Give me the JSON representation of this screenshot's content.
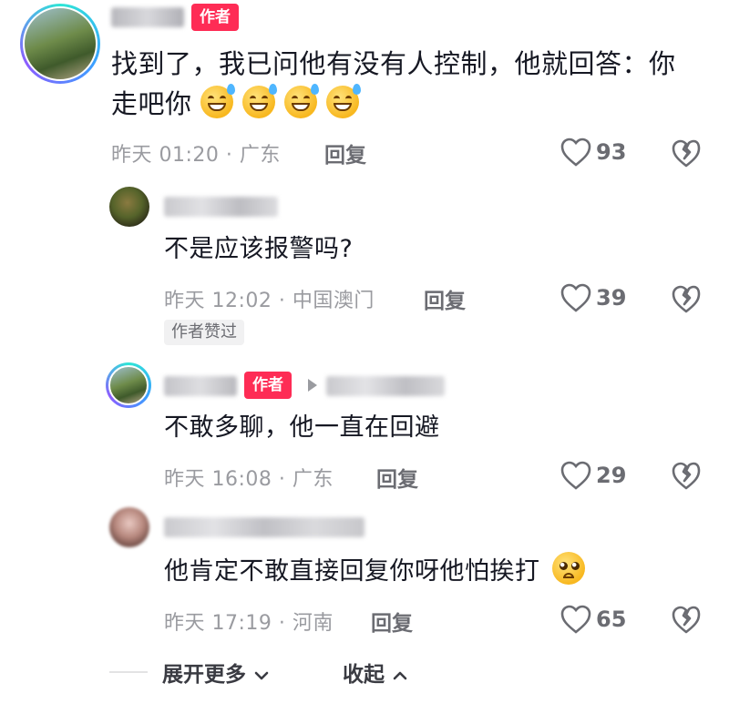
{
  "comments": [
    {
      "author_badge": "作者",
      "text": "找到了，我已问他有没有人控制，他就回答：你走吧你",
      "line1": "找到了，我已问他有没有人控制，他就回答：你",
      "line2": "走吧你",
      "emoji_icons": [
        "grinning-sweat-emoji",
        "grinning-sweat-emoji",
        "grinning-sweat-emoji",
        "grinning-sweat-emoji"
      ],
      "meta": "昨天 01:20 · 广东",
      "reply_label": "回复",
      "likes": "93"
    },
    {
      "text": "不是应该报警吗?",
      "meta": "昨天 12:02 · 中国澳门",
      "reply_label": "回复",
      "likes": "39",
      "liked_tag": "作者赞过"
    },
    {
      "author_badge": "作者",
      "text": "不敢多聊，他一直在回避",
      "meta": "昨天 16:08 · 广东",
      "reply_label": "回复",
      "likes": "29"
    },
    {
      "text": "他肯定不敢直接回复你呀他怕挨打",
      "emoji_icons": [
        "pleading-face-emoji"
      ],
      "meta": "昨天 17:19 · 河南",
      "reply_label": "回复",
      "likes": "65"
    }
  ],
  "footer": {
    "expand_label": "展开更多",
    "collapse_label": "收起"
  },
  "colors": {
    "author_badge_bg": "#fe2c55",
    "text_primary": "#161823",
    "text_meta": "#9a9ba0"
  }
}
